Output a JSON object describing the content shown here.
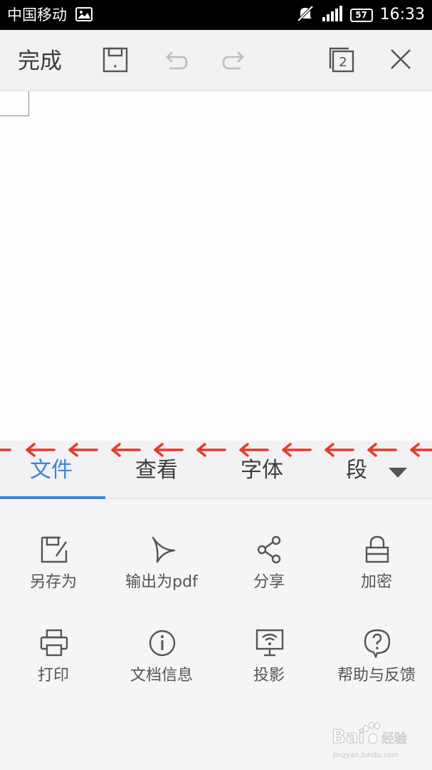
{
  "status_bar": {
    "carrier": "中国移动",
    "battery": "57",
    "time": "16:33"
  },
  "toolbar": {
    "done_label": "完成",
    "tab_count": "2",
    "icons": [
      "save-icon",
      "undo-icon",
      "redo-icon",
      "tab-switch-icon",
      "close-icon"
    ]
  },
  "tabs": [
    {
      "label": "文件",
      "active": true
    },
    {
      "label": "查看",
      "active": false
    },
    {
      "label": "字体",
      "active": false
    },
    {
      "label": "段",
      "active": false
    }
  ],
  "menu": {
    "items": [
      {
        "label": "另存为",
        "icon": "save-as-icon"
      },
      {
        "label": "输出为pdf",
        "icon": "export-pdf-icon"
      },
      {
        "label": "分享",
        "icon": "share-icon"
      },
      {
        "label": "加密",
        "icon": "lock-icon"
      },
      {
        "label": "打印",
        "icon": "printer-icon"
      },
      {
        "label": "文档信息",
        "icon": "info-icon"
      },
      {
        "label": "投影",
        "icon": "projection-icon"
      },
      {
        "label": "帮助与反馈",
        "icon": "help-icon"
      }
    ]
  },
  "colors": {
    "accent": "#3b86d6",
    "annotation_arrow": "#e23b2e",
    "status_bar": "#000000"
  },
  "watermark": {
    "brand": "Baidu经验",
    "url": "jingyan.baidu.com"
  }
}
